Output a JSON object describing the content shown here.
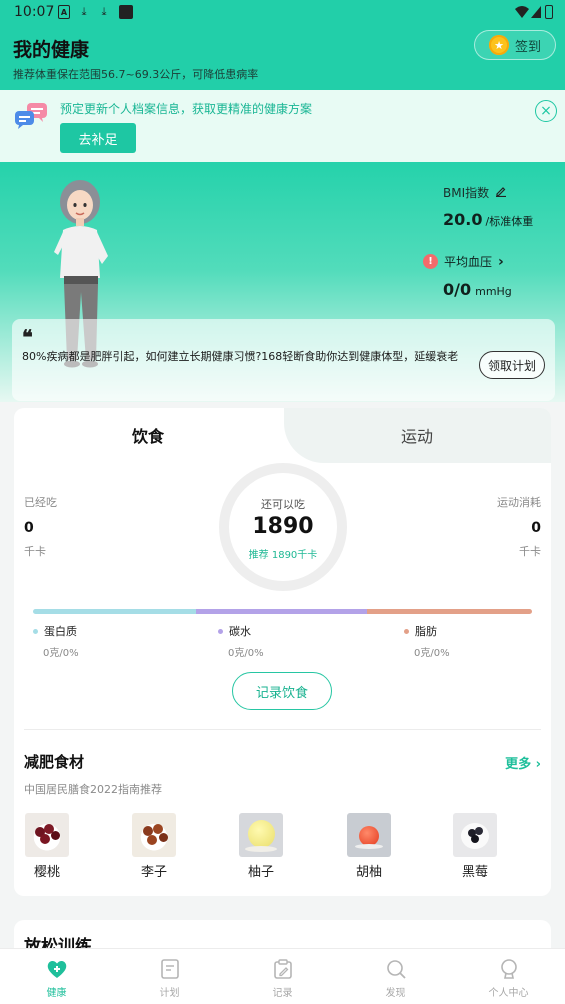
{
  "status_bar": {
    "time": "10:07",
    "notif_icons": [
      "A",
      "⤓",
      "⤓",
      "■"
    ]
  },
  "header": {
    "title": "我的健康",
    "subtitle": "推荐体重保在范围56.7~69.3公斤，可降低患病率",
    "signin_label": "签到"
  },
  "banner": {
    "message": "预定更新个人档案信息，获取更精准的健康方案",
    "button_label": "去补足",
    "close_symbol": "×"
  },
  "hero": {
    "bmi_label": "BMI指数",
    "bmi_value": "20.0",
    "bmi_status": "/标准体重",
    "bp_label": "平均血压",
    "bp_arrow": "›",
    "bp_value": "0/0",
    "bp_unit": "mmHg",
    "quote_mark": "❝",
    "quote_text": "80%疾病都是肥胖引起，如何建立长期健康习惯?168轻断食助你达到健康体型，延缓衰老",
    "plan_button": "领取计划"
  },
  "diet": {
    "tabs": [
      {
        "label": "饮食",
        "active": true
      },
      {
        "label": "运动",
        "active": false
      }
    ],
    "eaten_label": "已经吃",
    "eaten_value": "0",
    "eaten_unit": "千卡",
    "burn_label": "运动消耗",
    "burn_value": "0",
    "burn_unit": "千卡",
    "remaining_label": "还可以吃",
    "remaining_value": "1890",
    "recommend_text": "推荐 1890千卡",
    "macros": [
      {
        "name": "蛋白质",
        "amount": "0克/0%",
        "color": "#a5dde6"
      },
      {
        "name": "碳水",
        "amount": "0克/0%",
        "color": "#b3a2e8"
      },
      {
        "name": "脂肪",
        "amount": "0克/0%",
        "color": "#e3a088"
      }
    ],
    "record_button": "记录饮食"
  },
  "foods": {
    "title": "减肥食材",
    "more_label": "更多 ›",
    "subtitle": "中国居民膳食2022指南推荐",
    "items": [
      {
        "name": "樱桃",
        "icon": "cherry"
      },
      {
        "name": "李子",
        "icon": "plum"
      },
      {
        "name": "柚子",
        "icon": "pomelo"
      },
      {
        "name": "胡柚",
        "icon": "grapefruit"
      },
      {
        "name": "黑莓",
        "icon": "blackberry"
      }
    ]
  },
  "relax": {
    "title": "放松训练"
  },
  "bottom_nav": [
    {
      "label": "健康",
      "icon": "health-icon",
      "active": true
    },
    {
      "label": "计划",
      "icon": "plan-icon",
      "active": false
    },
    {
      "label": "记录",
      "icon": "record-icon",
      "active": false
    },
    {
      "label": "发现",
      "icon": "discover-icon",
      "active": false
    },
    {
      "label": "个人中心",
      "icon": "profile-icon",
      "active": false
    }
  ],
  "colors": {
    "brand": "#22cfa9",
    "accent_text": "#1fbf9b",
    "warning": "#f36b6b",
    "coin": "#fcc21b"
  }
}
